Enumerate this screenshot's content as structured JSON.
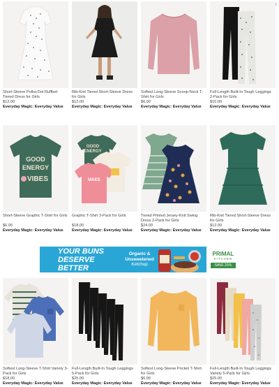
{
  "close_icon": "×",
  "rows": [
    [
      {
        "title": "Short-Sleeve Polka-Dot Ruffled-Tiered Dress for Girls",
        "price": "$12.00",
        "tag": "Everyday Magic: Everyday Value"
      },
      {
        "title": "Rib-Knit Tiered Short-Sleeve Dress for Girls",
        "price": "$12.00",
        "tag": "Everyday Magic: Everyday Value"
      },
      {
        "title": "Softest Long-Sleeve Scoop-Neck T-Shirt for Girls",
        "price": "$6.00",
        "tag": "Everyday Magic: Everyday Value"
      },
      {
        "title": "Full-Length Built-In Tough Leggings 2-Pack for Girls",
        "price": "$10.00",
        "tag": "Everyday Magic: Everyday Value"
      }
    ],
    [
      {
        "title": "Short-Sleeve Graphic T-Shirt for Girls",
        "price": "$6.00",
        "tag": "Everyday Magic: Everyday Value"
      },
      {
        "title": "Graphic T-Shirt 3-Pack for Girls",
        "price": "$18.00",
        "tag": "Everyday Magic: Everyday Value"
      },
      {
        "title": "Tiered Printed Jersey-Knit Swing Dress 2-Pack for Girls",
        "price": "$24.00",
        "tag": "Everyday Magic: Everyday Value"
      },
      {
        "title": "Rib-Knit Tiered Short-Sleeve Dress for Girls",
        "price": "$12.00",
        "tag": "Everyday Magic: Everyday Value"
      }
    ],
    [
      {
        "title": "Softest Long-Sleeve T-Shirt Variety 3-Pack for Girls",
        "price": "$18.00",
        "tag": "Everyday Magic: Everyday Value"
      },
      {
        "title": "Full-Length Built-In Tough Leggings 5-Pack for Girls",
        "price": "$25.00",
        "tag": "Everyday Magic: Everyday Value"
      },
      {
        "title": "Softest Long-Sleeve Pocket T-Shirt for Girls",
        "price": "$6.00",
        "tag": "Everyday Magic: Everyday Value"
      },
      {
        "title": "Full-Length Built-In Tough Leggings Variety 5-Pack for Girls",
        "price": "$25.00",
        "tag": "Everyday Magic: Everyday Value"
      }
    ]
  ],
  "graphic_tee_text": [
    "GOOD",
    "ENERGY",
    "VIBES"
  ],
  "banner": {
    "headline_1": "YOUR BUNS",
    "headline_2": "DESERVE BETTER",
    "mid_1": "Organic &",
    "mid_2": "Unsweetened",
    "mid_3": "Ketchup",
    "brand_1": "PRIMAL",
    "brand_2": "KITCHEN",
    "save": "SAVE 20%"
  }
}
